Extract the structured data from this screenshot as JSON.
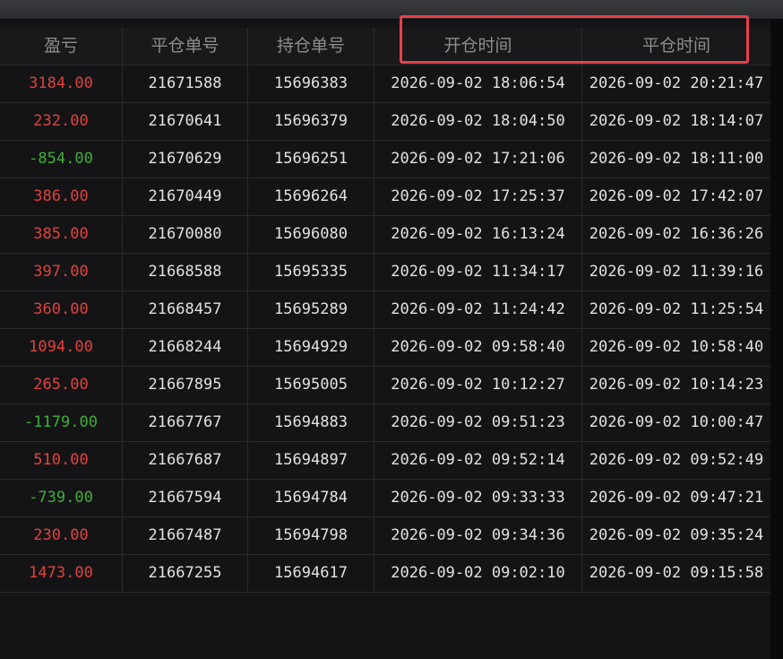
{
  "table": {
    "headers": [
      "盈亏",
      "平仓单号",
      "持仓单号",
      "开仓时间",
      "平仓时间"
    ],
    "rows": [
      {
        "pnl": "3184.00",
        "sign": "pos",
        "close_no": "21671588",
        "pos_no": "15696383",
        "open_time": "2026-09-02 18:06:54",
        "close_time": "2026-09-02 20:21:47"
      },
      {
        "pnl": "232.00",
        "sign": "pos",
        "close_no": "21670641",
        "pos_no": "15696379",
        "open_time": "2026-09-02 18:04:50",
        "close_time": "2026-09-02 18:14:07"
      },
      {
        "pnl": "-854.00",
        "sign": "neg",
        "close_no": "21670629",
        "pos_no": "15696251",
        "open_time": "2026-09-02 17:21:06",
        "close_time": "2026-09-02 18:11:00"
      },
      {
        "pnl": "386.00",
        "sign": "pos",
        "close_no": "21670449",
        "pos_no": "15696264",
        "open_time": "2026-09-02 17:25:37",
        "close_time": "2026-09-02 17:42:07"
      },
      {
        "pnl": "385.00",
        "sign": "pos",
        "close_no": "21670080",
        "pos_no": "15696080",
        "open_time": "2026-09-02 16:13:24",
        "close_time": "2026-09-02 16:36:26"
      },
      {
        "pnl": "397.00",
        "sign": "pos",
        "close_no": "21668588",
        "pos_no": "15695335",
        "open_time": "2026-09-02 11:34:17",
        "close_time": "2026-09-02 11:39:16"
      },
      {
        "pnl": "360.00",
        "sign": "pos",
        "close_no": "21668457",
        "pos_no": "15695289",
        "open_time": "2026-09-02 11:24:42",
        "close_time": "2026-09-02 11:25:54"
      },
      {
        "pnl": "1094.00",
        "sign": "pos",
        "close_no": "21668244",
        "pos_no": "15694929",
        "open_time": "2026-09-02 09:58:40",
        "close_time": "2026-09-02 10:58:40"
      },
      {
        "pnl": "265.00",
        "sign": "pos",
        "close_no": "21667895",
        "pos_no": "15695005",
        "open_time": "2026-09-02 10:12:27",
        "close_time": "2026-09-02 10:14:23"
      },
      {
        "pnl": "-1179.00",
        "sign": "neg",
        "close_no": "21667767",
        "pos_no": "15694883",
        "open_time": "2026-09-02 09:51:23",
        "close_time": "2026-09-02 10:00:47"
      },
      {
        "pnl": "510.00",
        "sign": "pos",
        "close_no": "21667687",
        "pos_no": "15694897",
        "open_time": "2026-09-02 09:52:14",
        "close_time": "2026-09-02 09:52:49"
      },
      {
        "pnl": "-739.00",
        "sign": "neg",
        "close_no": "21667594",
        "pos_no": "15694784",
        "open_time": "2026-09-02 09:33:33",
        "close_time": "2026-09-02 09:47:21"
      },
      {
        "pnl": "230.00",
        "sign": "pos",
        "close_no": "21667487",
        "pos_no": "15694798",
        "open_time": "2026-09-02 09:34:36",
        "close_time": "2026-09-02 09:35:24"
      },
      {
        "pnl": "1473.00",
        "sign": "pos",
        "close_no": "21667255",
        "pos_no": "15694617",
        "open_time": "2026-09-02 09:02:10",
        "close_time": "2026-09-02 09:15:58"
      }
    ]
  },
  "colors": {
    "profit": "#e0433e",
    "loss": "#3fae3a",
    "highlight": "#e8414a"
  }
}
